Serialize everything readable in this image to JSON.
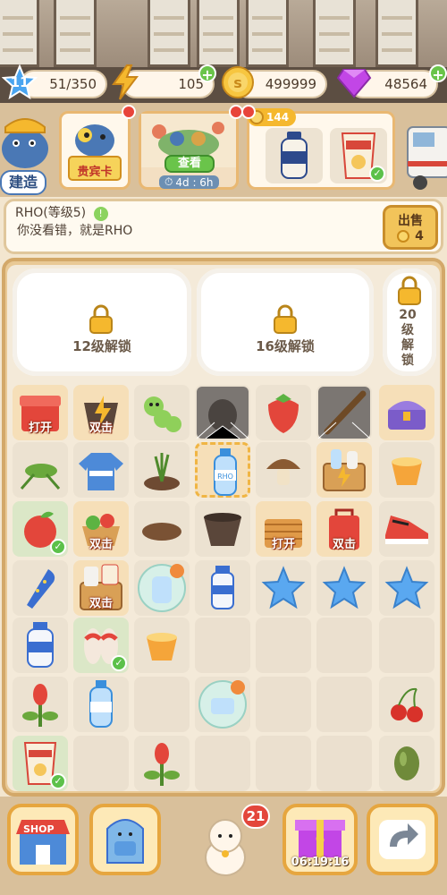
{
  "stats": {
    "level": "11",
    "xp": "51/350",
    "energy": "105",
    "coins": "499999",
    "gems": "48564"
  },
  "cards": {
    "vip_label": "贵宾卡",
    "view_label": "查看",
    "timer": "4d : 6h",
    "order_coins": "144",
    "build_label": "建造"
  },
  "info": {
    "name": "RHO(等级5)",
    "description": "你没看错，就是RHO",
    "sell_label": "出售",
    "sell_price": "4"
  },
  "board": {
    "unlock_12": "12级解锁",
    "unlock_16": "16级解锁",
    "unlock_20": "20级解锁",
    "open_label": "打开",
    "double_label": "双击"
  },
  "bottom": {
    "shop_label": "SHOP",
    "notification_count": "21",
    "gift_timer": "06:19:16"
  },
  "colors": {
    "accent": "#e6a63f",
    "energy": "#f5b82e",
    "gem": "#c246e6",
    "star": "#5aa8f0"
  }
}
